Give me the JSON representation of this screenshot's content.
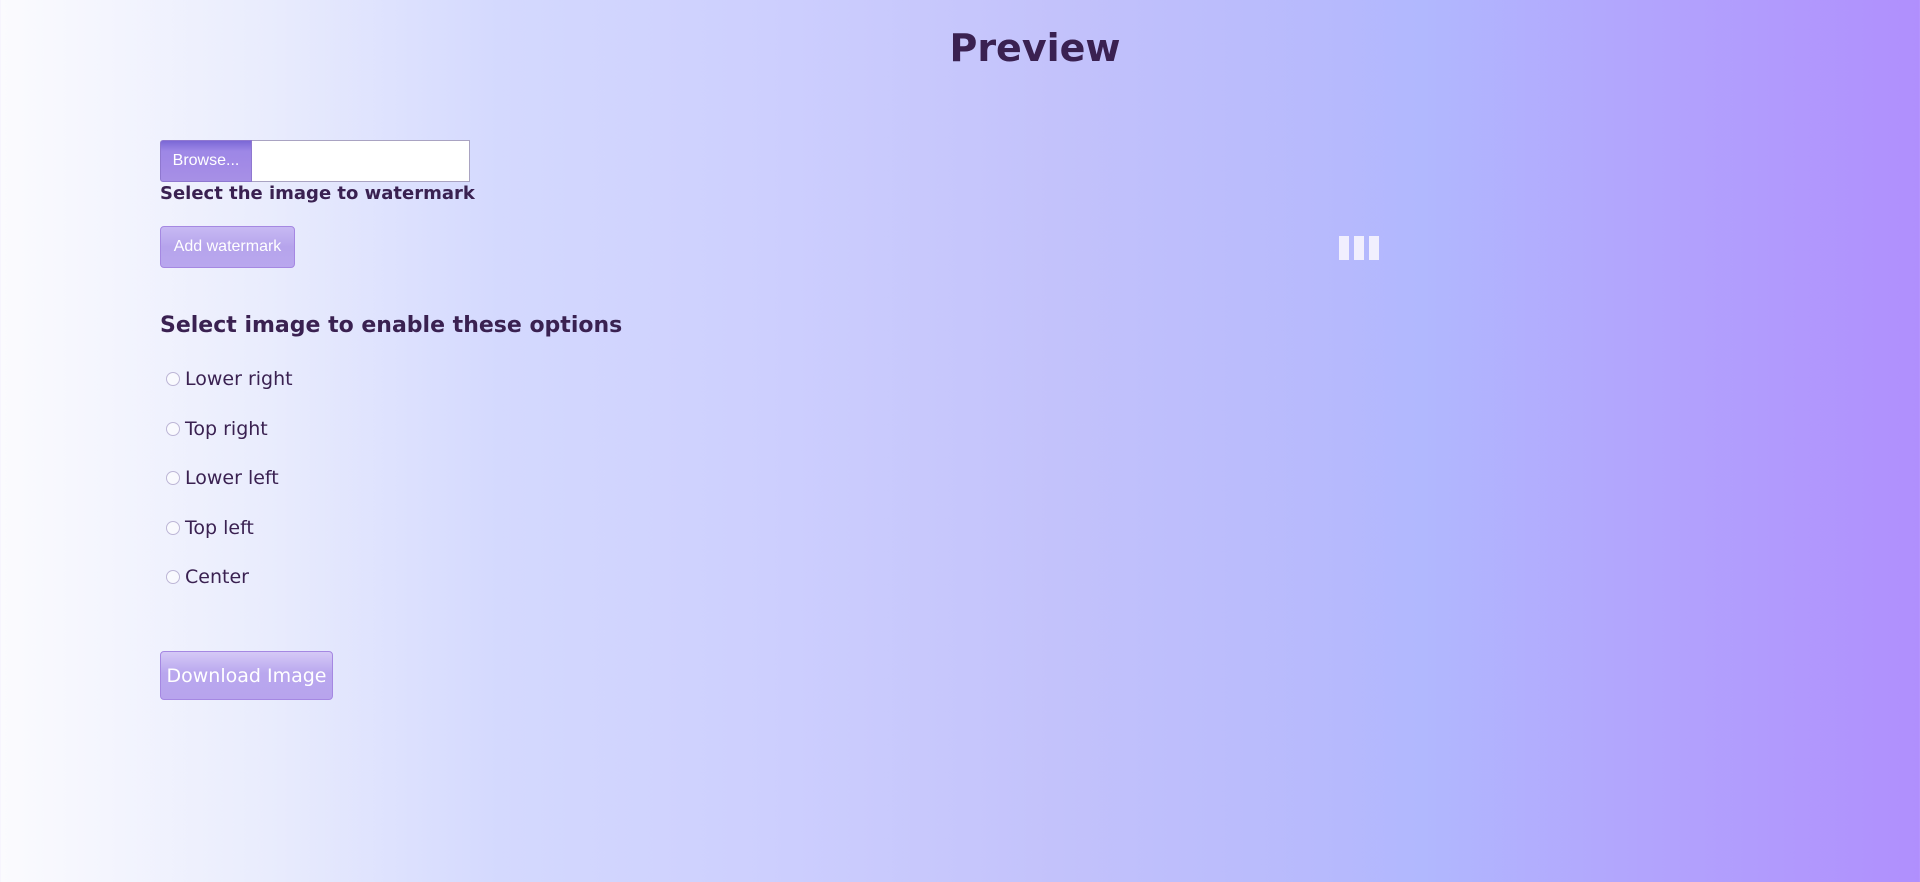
{
  "header": {
    "title": "Preview"
  },
  "uploader": {
    "browse_label": "Browse...",
    "file_name": "",
    "select_label": "Select the image to watermark",
    "add_watermark_label": "Add watermark"
  },
  "options": {
    "heading": "Select image to enable these options",
    "positions": [
      {
        "label": "Lower right",
        "checked": false
      },
      {
        "label": "Top right",
        "checked": false
      },
      {
        "label": "Lower left",
        "checked": false
      },
      {
        "label": "Top left",
        "checked": false
      },
      {
        "label": "Center",
        "checked": false
      }
    ]
  },
  "actions": {
    "download_label": "Download Image"
  },
  "icons": {
    "loader": "loading-bars-icon"
  },
  "colors": {
    "text": "#3a2151",
    "button": "#b9a7ee",
    "button_border": "#a588e2",
    "browse": "#a28ae6"
  }
}
